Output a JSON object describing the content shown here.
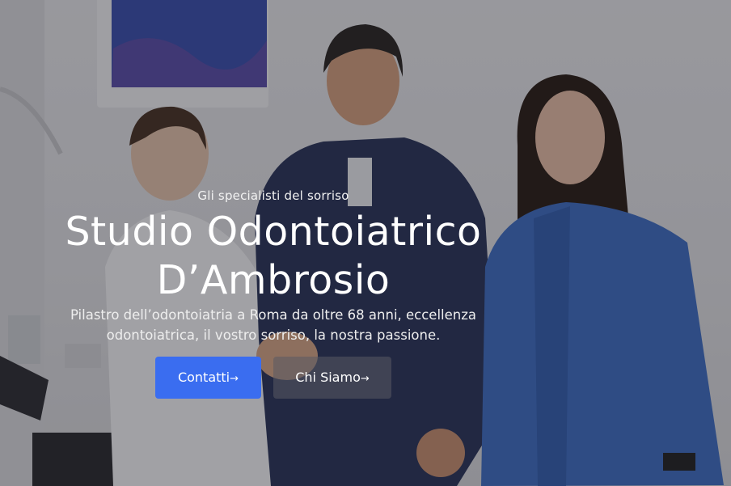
{
  "hero": {
    "eyebrow": "Gli specialisti del sorriso",
    "title_line1": "Studio Odontoiatrico",
    "title_line2": "D’Ambrosio",
    "subtitle_line1": "Pilastro dell’odontoiatria a Roma da oltre 68 anni, eccellenza",
    "subtitle_line2": "odontoiatrica, il vostro sorriso, la nostra passione.",
    "buttons": {
      "primary_label": "Contatti",
      "secondary_label": "Chi Siamo",
      "arrow_icon": "arrow-right-icon",
      "arrow_glyph": "→"
    }
  },
  "colors": {
    "primary": "#3a6df0",
    "overlay": "rgba(20,20,28,0.38)",
    "text": "#ffffff"
  }
}
